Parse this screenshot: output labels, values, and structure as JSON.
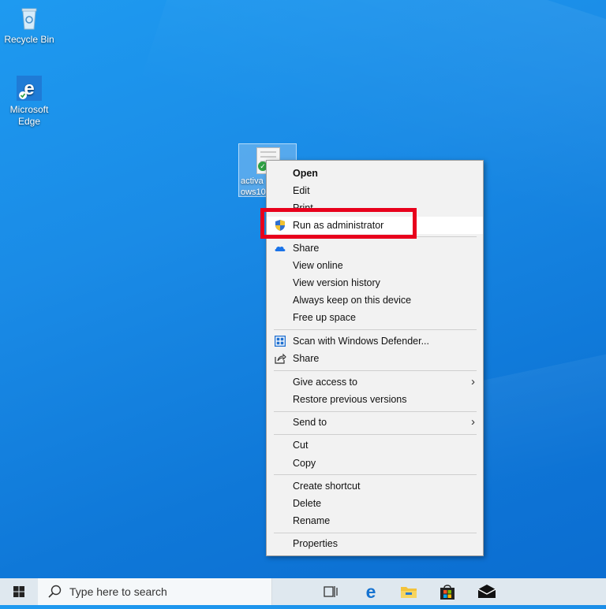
{
  "desktop": {
    "icons": [
      {
        "label": "Recycle Bin",
        "icon": "recycle-bin-icon"
      },
      {
        "label": "Microsoft\nEdge",
        "icon": "edge-icon"
      }
    ],
    "selected_file": {
      "label": "activa\nows10",
      "icon": "document-icon"
    }
  },
  "context_menu": {
    "items": [
      {
        "label": "Open",
        "bold": true
      },
      {
        "label": "Edit"
      },
      {
        "label": "Print"
      },
      {
        "label": "Run as administrator",
        "icon": "uac-shield-icon",
        "highlighted": true
      },
      {
        "label": "Share",
        "icon": "onedrive-icon"
      },
      {
        "label": "View online"
      },
      {
        "label": "View version history"
      },
      {
        "label": "Always keep on this device"
      },
      {
        "label": "Free up space"
      },
      {
        "label": "Scan with Windows Defender...",
        "icon": "defender-icon"
      },
      {
        "label": "Share",
        "icon": "share-icon"
      },
      {
        "label": "Give access to",
        "submenu": true
      },
      {
        "label": "Restore previous versions"
      },
      {
        "label": "Send to",
        "submenu": true
      },
      {
        "label": "Cut"
      },
      {
        "label": "Copy"
      },
      {
        "label": "Create shortcut"
      },
      {
        "label": "Delete"
      },
      {
        "label": "Rename"
      },
      {
        "label": "Properties"
      }
    ]
  },
  "annotation": {
    "color": "#e8001c"
  },
  "taskbar": {
    "search_placeholder": "Type here to search",
    "icons": [
      "task-view-icon",
      "edge-icon",
      "file-explorer-icon",
      "store-icon",
      "mail-icon"
    ]
  },
  "colors": {
    "desktop": "#1a8be6",
    "menu_bg": "#f2f2f2",
    "highlight": "#ffffff"
  }
}
